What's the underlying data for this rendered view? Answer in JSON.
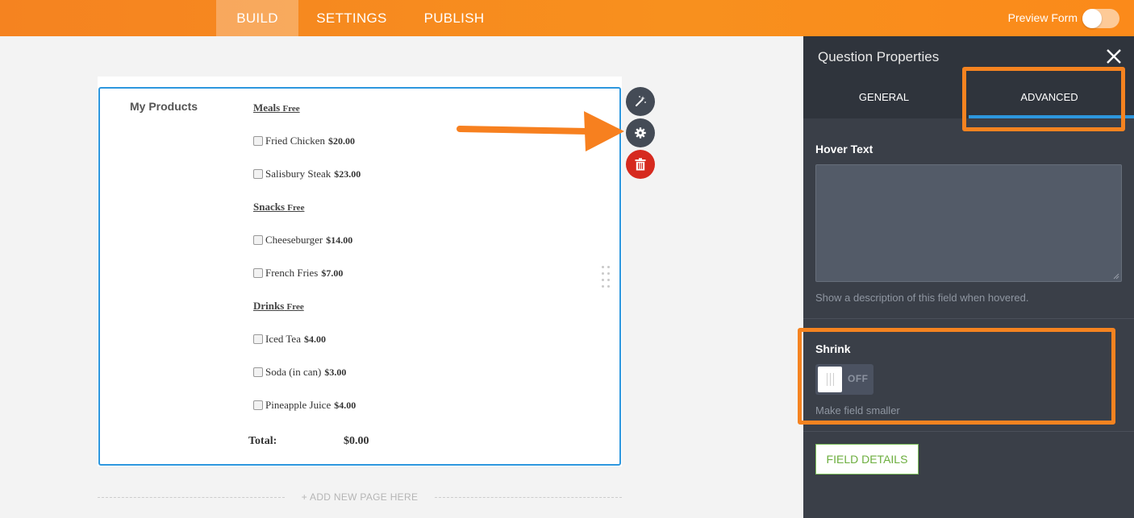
{
  "topbar": {
    "tabs": [
      {
        "label": "BUILD",
        "active": true
      },
      {
        "label": "SETTINGS",
        "active": false
      },
      {
        "label": "PUBLISH",
        "active": false
      }
    ],
    "preview_label": "Preview Form",
    "preview_on": false,
    "accent_color": "#f58320"
  },
  "form": {
    "field_label": "My Products",
    "categories": [
      {
        "name": "Meals",
        "tag": "Free",
        "items": [
          {
            "name": "Fried Chicken",
            "price": "$20.00"
          },
          {
            "name": "Salisbury Steak",
            "price": "$23.00"
          }
        ]
      },
      {
        "name": "Snacks",
        "tag": "Free",
        "items": [
          {
            "name": "Cheeseburger",
            "price": "$14.00"
          },
          {
            "name": "French Fries",
            "price": "$7.00"
          }
        ]
      },
      {
        "name": "Drinks",
        "tag": "Free",
        "items": [
          {
            "name": "Iced Tea",
            "price": "$4.00"
          },
          {
            "name": "Soda (in can)",
            "price": "$3.00"
          },
          {
            "name": "Pineapple Juice",
            "price": "$4.00"
          }
        ]
      }
    ],
    "total_label": "Total:",
    "total_value": "$0.00",
    "add_page": "+ ADD NEW PAGE HERE",
    "actions": [
      "wand-icon",
      "gear-icon",
      "trash-icon"
    ]
  },
  "panel": {
    "title": "Question Properties",
    "tabs": [
      {
        "label": "GENERAL",
        "active": false
      },
      {
        "label": "ADVANCED",
        "active": true
      }
    ],
    "hover_text": {
      "label": "Hover Text",
      "value": "",
      "hint": "Show a description of this field when hovered."
    },
    "shrink": {
      "label": "Shrink",
      "state": "OFF",
      "hint": "Make field smaller"
    },
    "field_details_button": "FIELD DETAILS"
  }
}
